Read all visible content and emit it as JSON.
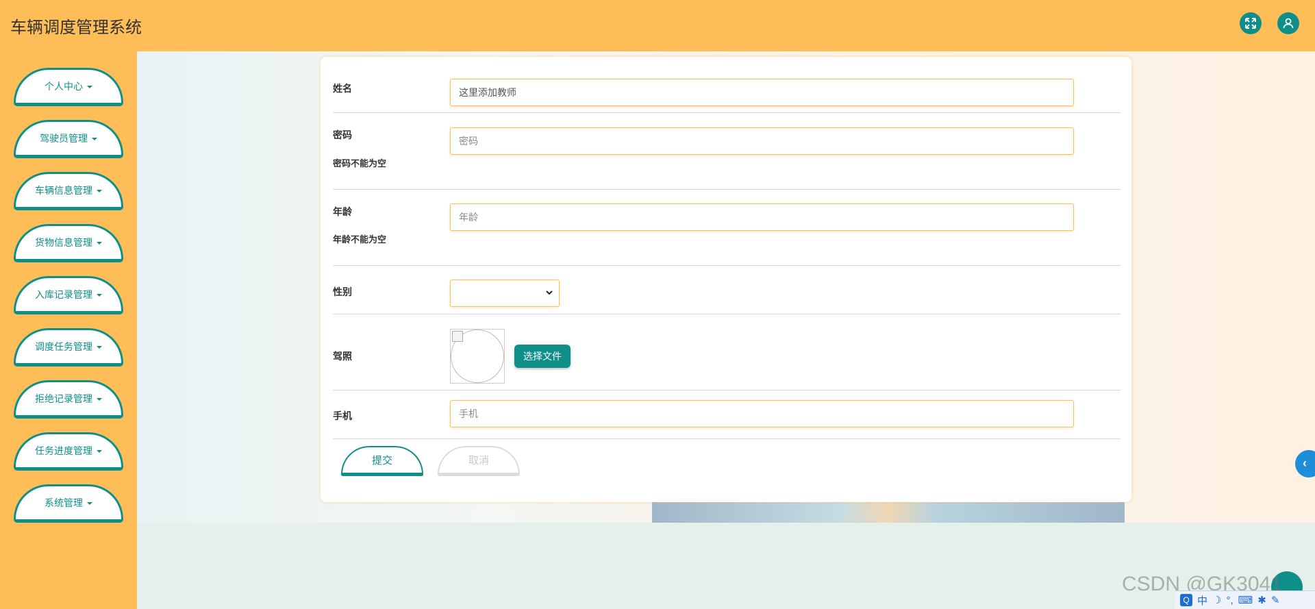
{
  "app": {
    "title": "车辆调度管理系统"
  },
  "header": {
    "icons": [
      "fullscreen-icon",
      "user-icon"
    ]
  },
  "sidebar": {
    "items": [
      {
        "label": "个人中心"
      },
      {
        "label": "驾驶员管理"
      },
      {
        "label": "车辆信息管理"
      },
      {
        "label": "货物信息管理"
      },
      {
        "label": "入库记录管理"
      },
      {
        "label": "调度任务管理"
      },
      {
        "label": "拒绝记录管理"
      },
      {
        "label": "任务进度管理"
      },
      {
        "label": "系统管理"
      }
    ]
  },
  "form": {
    "name": {
      "label": "姓名",
      "value": "这里添加教师"
    },
    "password": {
      "label": "密码",
      "placeholder": "密码",
      "error": "密码不能为空"
    },
    "age": {
      "label": "年龄",
      "placeholder": "年龄",
      "error": "年龄不能为空"
    },
    "gender": {
      "label": "性别",
      "selected": ""
    },
    "license": {
      "label": "驾照",
      "upload_button": "选择文件"
    },
    "phone": {
      "label": "手机",
      "placeholder": "手机"
    },
    "submit_label": "提交",
    "cancel_label": "取消"
  },
  "watermark": "CSDN @GK3041",
  "ime": {
    "logo": "Q",
    "mode": "中"
  },
  "colors": {
    "primary": "#0f8f8a",
    "header_bg": "#ffbd58",
    "accent_blue": "#1e8ed8"
  }
}
